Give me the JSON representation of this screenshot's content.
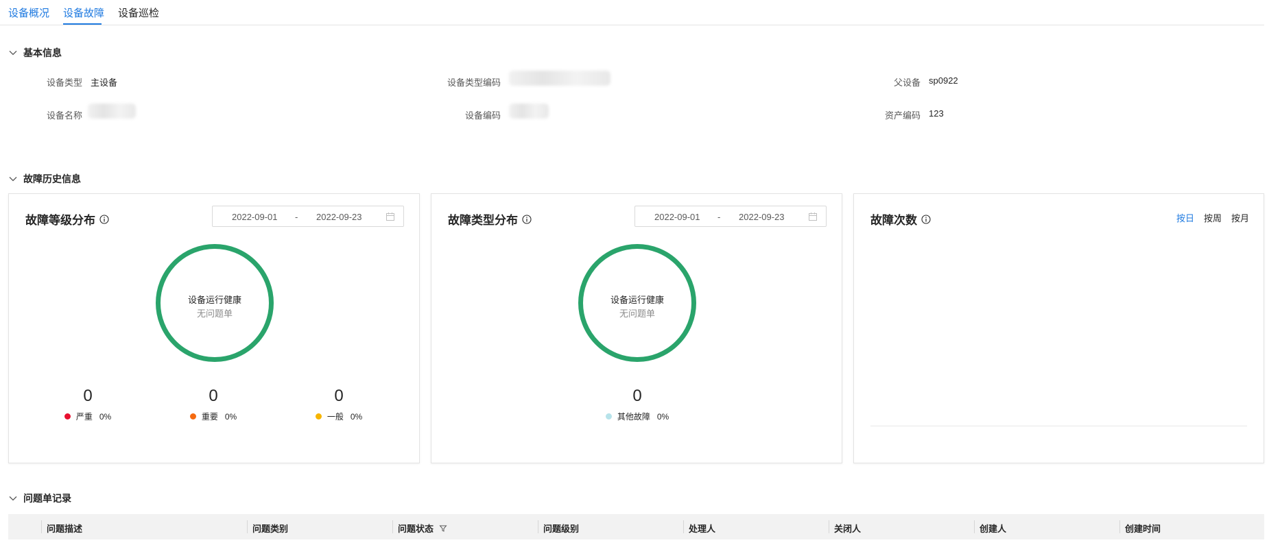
{
  "tabs": [
    {
      "label": "设备概况"
    },
    {
      "label": "设备故障"
    },
    {
      "label": "设备巡检"
    }
  ],
  "basic_info": {
    "title": "基本信息",
    "device_type_label": "设备类型",
    "device_type_value": "主设备",
    "device_type_code_label": "设备类型编码",
    "parent_device_label": "父设备",
    "parent_device_value": "sp0922",
    "device_name_label": "设备名称",
    "device_code_label": "设备编码",
    "asset_code_label": "资产编码",
    "asset_code_value": "123"
  },
  "fault_history": {
    "title": "故障历史信息",
    "level_card": {
      "title": "故障等级分布",
      "date_start": "2022-09-01",
      "date_sep": "-",
      "date_end": "2022-09-23",
      "ring_title": "设备运行健康",
      "ring_sub": "无问题单",
      "stats": [
        {
          "count": "0",
          "label": "严重",
          "pct": "0%",
          "color": "#e8102f"
        },
        {
          "count": "0",
          "label": "重要",
          "pct": "0%",
          "color": "#f56a10"
        },
        {
          "count": "0",
          "label": "一般",
          "pct": "0%",
          "color": "#f7b500"
        }
      ]
    },
    "type_card": {
      "title": "故障类型分布",
      "date_start": "2022-09-01",
      "date_sep": "-",
      "date_end": "2022-09-23",
      "ring_title": "设备运行健康",
      "ring_sub": "无问题单",
      "stats": [
        {
          "count": "0",
          "label": "其他故障",
          "pct": "0%",
          "color": "#b7e3ea"
        }
      ]
    },
    "count_card": {
      "title": "故障次数",
      "granularity": [
        "按日",
        "按周",
        "按月"
      ],
      "active_granularity": "按日"
    },
    "ring_color": "#2aa46b"
  },
  "issue_records": {
    "title": "问题单记录",
    "columns": [
      "问题描述",
      "问题类别",
      "问题状态",
      "问题级别",
      "处理人",
      "关闭人",
      "创建人",
      "创建时间"
    ]
  },
  "colors": {
    "accent": "#1f7ae0"
  }
}
